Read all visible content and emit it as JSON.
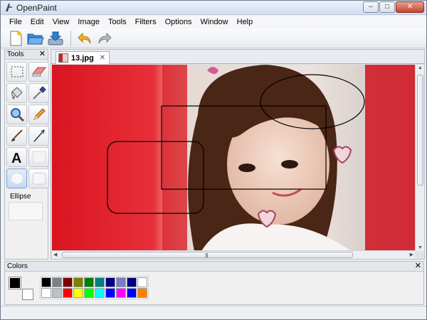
{
  "window": {
    "title": "OpenPaint",
    "controls": [
      "–",
      "□",
      "✕"
    ]
  },
  "menu": [
    "File",
    "Edit",
    "View",
    "Image",
    "Tools",
    "Filters",
    "Options",
    "Window",
    "Help"
  ],
  "toolbar": {
    "buttons": [
      "new-document",
      "open-folder",
      "save",
      "undo",
      "redo"
    ]
  },
  "tools_panel": {
    "title": "Tools",
    "close": "✕",
    "tools": [
      "rectangle-select",
      "eraser",
      "paint-bucket",
      "color-picker",
      "zoom",
      "pencil",
      "brush",
      "line",
      "text",
      "rectangle",
      "ellipse",
      "rounded-rectangle"
    ],
    "active_tool": "ellipse",
    "active_label": "Ellipse"
  },
  "document": {
    "tab_label": "13.jpg",
    "tab_close": "✕",
    "scroll_grip": "III"
  },
  "colors_panel": {
    "title": "Colors",
    "close": "✕",
    "primary": "#000000",
    "secondary": "#ffffff",
    "palette": [
      "#000000",
      "#808080",
      "#800000",
      "#808000",
      "#008000",
      "#008080",
      "#000080",
      "#7b7bc6",
      "#000080",
      "#ffffff",
      "#ffffff",
      "#c0c0c0",
      "#ff0000",
      "#ffff00",
      "#00ff00",
      "#00ffff",
      "#0000ff",
      "#ff00ff",
      "#0000ff",
      "#ff8000"
    ]
  }
}
